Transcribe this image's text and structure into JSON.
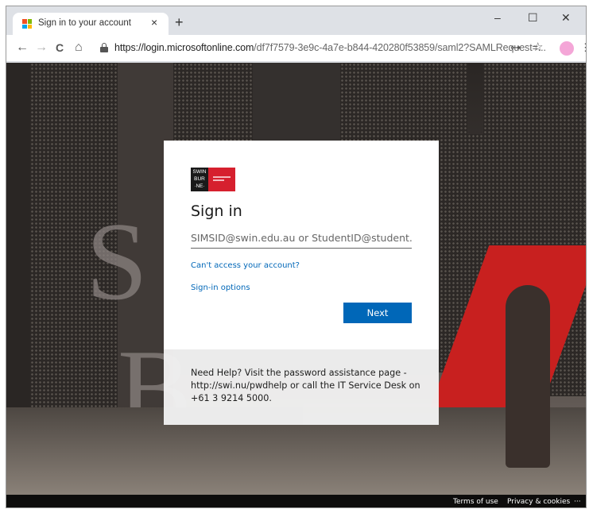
{
  "browser": {
    "tab_title": "Sign in to your account",
    "tab_close": "×",
    "new_tab": "+",
    "window_controls": {
      "minimize": "–",
      "maximize": "☐",
      "close": "✕"
    },
    "nav": {
      "back": "←",
      "forward": "→",
      "reload": "C",
      "home": "⌂"
    },
    "url_domain": "https://login.microsoftonline.com",
    "url_path": "/df7f7579-3e9c-4a7e-b844-420280f53859/saml2?SAMLRequest=...",
    "key_icon": "⊶",
    "star_icon": "☆",
    "menu_icon": "⋮"
  },
  "signin": {
    "logo_text": "SWIN BUR ·NE·",
    "heading": "Sign in",
    "username_placeholder": "SIMSID@swin.edu.au or StudentID@student.swin.edu.au",
    "cant_access_link": "Can't access your account?",
    "signin_options_link": "Sign-in options",
    "next_button": "Next"
  },
  "help": {
    "text": "Need Help? Visit the password assistance page - http://swi.nu/pwdhelp or call the IT Service Desk on +61 3 9214 5000."
  },
  "footer": {
    "terms": "Terms of use",
    "privacy": "Privacy & cookies",
    "more": "···"
  },
  "colors": {
    "accent": "#0067b8",
    "brand_red": "#d6202e"
  }
}
